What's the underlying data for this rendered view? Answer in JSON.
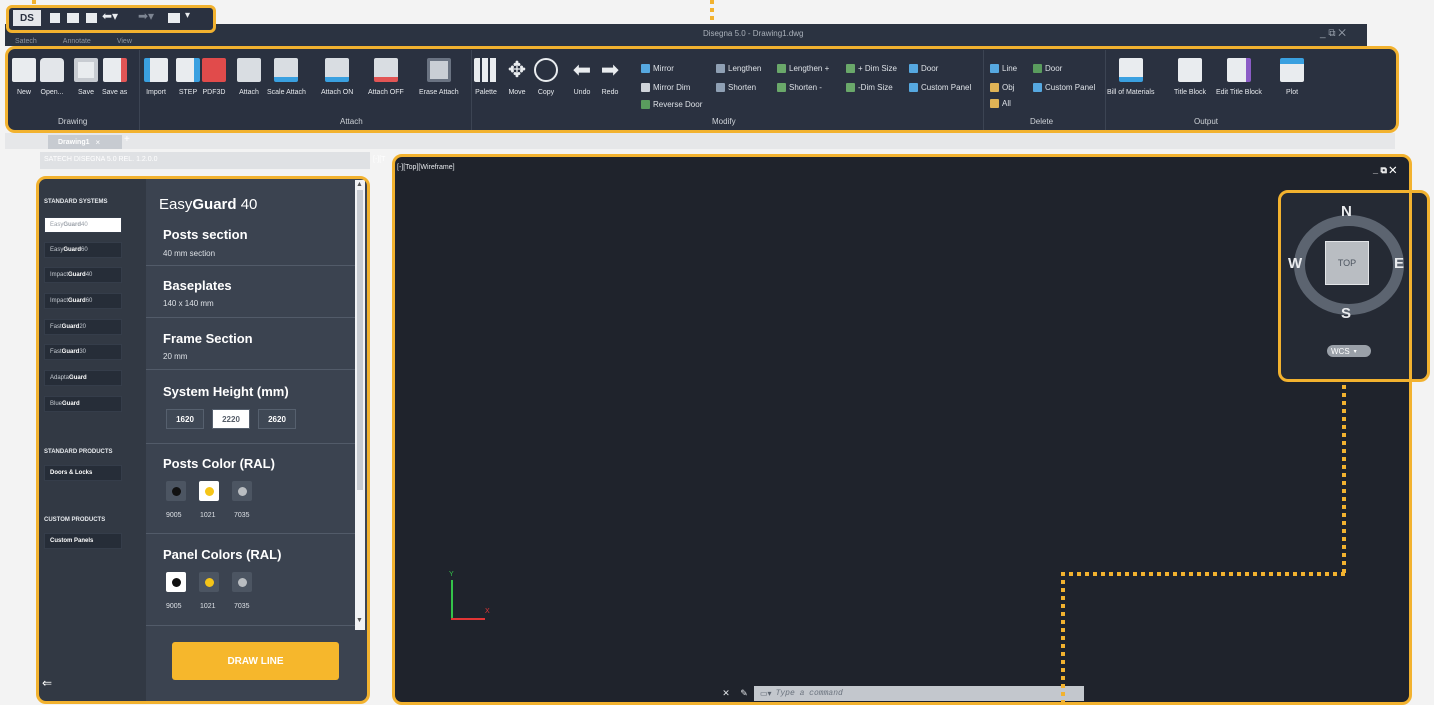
{
  "app": {
    "logo": "DS",
    "window_title": "Disegna 5.0 - Drawing1.dwg",
    "ribbon_tabs": [
      "Satech",
      "Annotate",
      "View"
    ],
    "doc_tab": "Drawing1",
    "doc_tab_close": "×",
    "doc_tab_add": "+",
    "panel_header": "SATECH DISEGNA 5.0 REL. 1.2.0.0",
    "window_controls": "_ ⧉ ✕"
  },
  "colors": {
    "accent": "#f2b22f",
    "ribbon_bg": "#2a3140",
    "panel_bg": "#3b4350",
    "sidebar_bg": "#323944",
    "viewport_bg": "#1f232c",
    "draw_button": "#f6b72c"
  },
  "ribbon": {
    "groups": {
      "drawing": "Drawing",
      "attach": "Attach",
      "modify": "Modify",
      "delete": "Delete",
      "output": "Output"
    },
    "buttons": {
      "new": "New",
      "open": "Open...",
      "save": "Save",
      "save_as": "Save as",
      "import": "Import",
      "step": "STEP",
      "pdf3d": "PDF3D",
      "attach": "Attach",
      "scale_attach": "Scale Attach",
      "attach_on": "Attach ON",
      "attach_off": "Attach OFF",
      "erase_attach": "Erase Attach",
      "palette": "Palette",
      "move": "Move",
      "copy": "Copy",
      "undo": "Undo",
      "redo": "Redo",
      "bill": "Bill of Materials",
      "title_block": "Title Block",
      "edit_title_block": "Edit Title Block",
      "plot": "Plot"
    },
    "modify": {
      "mirror": "Mirror",
      "mirror_dim": "Mirror Dim",
      "reverse_door": "Reverse Door",
      "lengthen": "Lengthen",
      "shorten": "Shorten",
      "lengthen_plus": "Lengthen +",
      "shorten_minus": "Shorten -",
      "dim_size_plus": "+ Dim Size",
      "dim_size_minus": "-Dim Size",
      "door": "Door",
      "custom_panel": "Custom Panel"
    },
    "delete": {
      "line": "Line",
      "door": "Door",
      "obj": "Obj",
      "custom_panel": "Custom Panel",
      "all": "All"
    }
  },
  "sidebar": {
    "standard_systems": "STANDARD SYSTEMS",
    "systems": [
      {
        "prefix": "Easy",
        "bold": "Guard",
        "suffix": " 40"
      },
      {
        "prefix": "Easy",
        "bold": "Guard",
        "suffix": " 60"
      },
      {
        "prefix": "Impact",
        "bold": "Guard",
        "suffix": " 40"
      },
      {
        "prefix": "Impact",
        "bold": "Guard",
        "suffix": " 60"
      },
      {
        "prefix": "Fast",
        "bold": "Guard",
        "suffix": " 20"
      },
      {
        "prefix": "Fast",
        "bold": "Guard",
        "suffix": " 30"
      },
      {
        "prefix": "Adapta",
        "bold": "Guard",
        "suffix": ""
      },
      {
        "prefix": "Blue",
        "bold": "Guard",
        "suffix": ""
      }
    ],
    "standard_products": "STANDARD PRODUCTS",
    "doors_locks": "Doors & Locks",
    "custom_products": "CUSTOM PRODUCTS",
    "custom_panels": "Custom Panels",
    "back_arrow": "⇐"
  },
  "details": {
    "title_prefix": "Easy",
    "title_bold": "Guard",
    "title_suffix": " 40",
    "posts_section": "Posts section",
    "posts_section_value": "40 mm section",
    "baseplates": "Baseplates",
    "baseplates_value": "140 x 140 mm",
    "frame_section": "Frame Section",
    "frame_section_value": "20 mm",
    "system_height": "System Height (mm)",
    "heights": [
      "1620",
      "2220",
      "2620"
    ],
    "posts_color": "Posts Color (RAL)",
    "panel_colors": "Panel Colors (RAL)",
    "ral": [
      "9005",
      "1021",
      "7035"
    ],
    "ral_hex": [
      "#111111",
      "#f5c518",
      "#b9bdc1"
    ],
    "draw_line": "DRAW LINE"
  },
  "viewport": {
    "label": "[-][Top][Wireframe]",
    "partial_label": "[-][T",
    "controls": "_ ⧉ ✕",
    "viewcube": {
      "n": "N",
      "s": "S",
      "e": "E",
      "w": "W",
      "top": "TOP",
      "wcs": "WCS"
    },
    "axis": {
      "x": "X",
      "y": "Y"
    },
    "command_placeholder": "Type a command"
  }
}
